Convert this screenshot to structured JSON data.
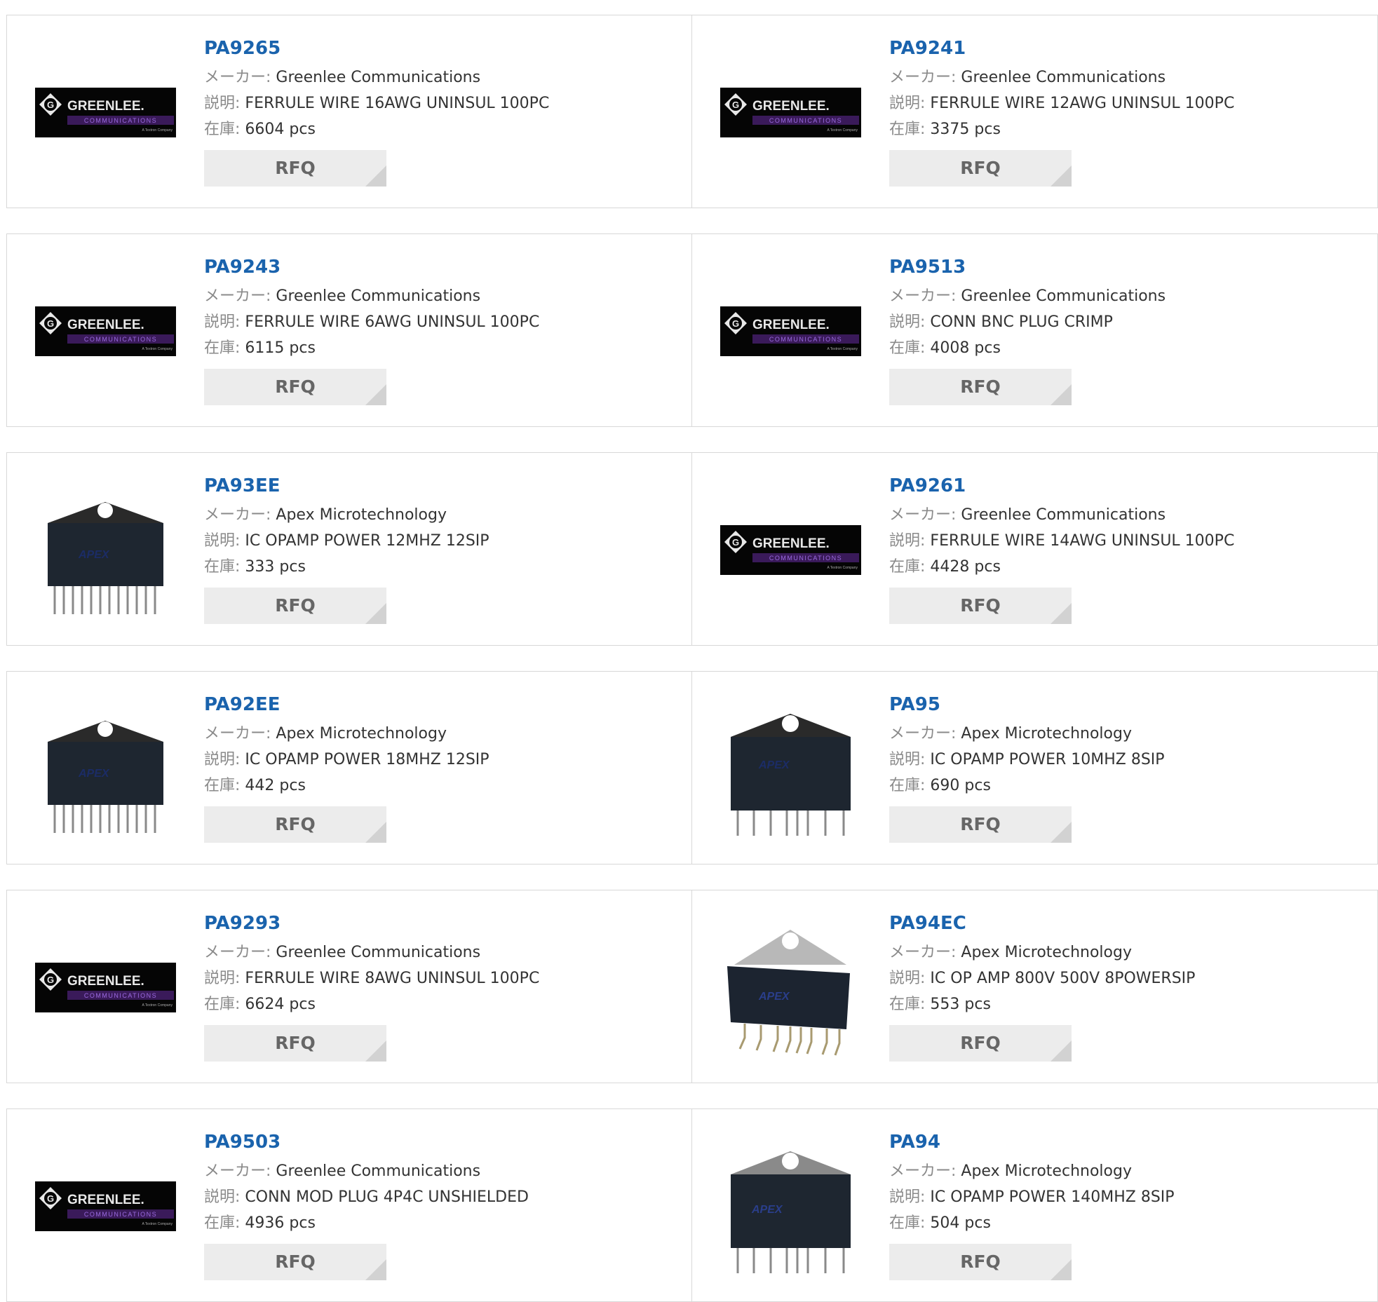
{
  "labels": {
    "maker": "メーカー:",
    "desc": "説明:",
    "stock": "在庫:"
  },
  "rfq_label": "RFQ",
  "logos": {
    "greenlee_wordmark": "GREENLEE.",
    "greenlee_sub": "COMMUNICATIONS",
    "greenlee_tag": "A Textron Company",
    "apex_mark": "APEX"
  },
  "colors": {
    "part_link": "#1a63ad",
    "label_gray": "#8a8a8a",
    "rfq_bg": "#ececec",
    "card_border": "#d8d8d8",
    "greenlee_purple": "#7b3fb5"
  },
  "products": [
    {
      "part": "PA9265",
      "maker": "Greenlee Communications",
      "desc": "FERRULE WIRE 16AWG UNINSUL 100PC",
      "stock": "6604 pcs",
      "image": "greenlee-logo"
    },
    {
      "part": "PA9241",
      "maker": "Greenlee Communications",
      "desc": "FERRULE WIRE 12AWG UNINSUL 100PC",
      "stock": "3375 pcs",
      "image": "greenlee-logo"
    },
    {
      "part": "PA9243",
      "maker": "Greenlee Communications",
      "desc": "FERRULE WIRE 6AWG UNINSUL 100PC",
      "stock": "6115 pcs",
      "image": "greenlee-logo"
    },
    {
      "part": "PA9513",
      "maker": "Greenlee Communications",
      "desc": "CONN BNC PLUG CRIMP",
      "stock": "4008 pcs",
      "image": "greenlee-logo"
    },
    {
      "part": "PA93EE",
      "maker": "Apex Microtechnology",
      "desc": "IC OPAMP POWER 12MHZ 12SIP",
      "stock": "333 pcs",
      "image": "sip-12pin-chip"
    },
    {
      "part": "PA9261",
      "maker": "Greenlee Communications",
      "desc": "FERRULE WIRE 14AWG UNINSUL 100PC",
      "stock": "4428 pcs",
      "image": "greenlee-logo"
    },
    {
      "part": "PA92EE",
      "maker": "Apex Microtechnology",
      "desc": "IC OPAMP POWER 18MHZ 12SIP",
      "stock": "442 pcs",
      "image": "sip-12pin-chip"
    },
    {
      "part": "PA95",
      "maker": "Apex Microtechnology",
      "desc": "IC OPAMP POWER 10MHZ 8SIP",
      "stock": "690 pcs",
      "image": "sip-8pin-chip"
    },
    {
      "part": "PA9293",
      "maker": "Greenlee Communications",
      "desc": "FERRULE WIRE 8AWG UNINSUL 100PC",
      "stock": "6624 pcs",
      "image": "greenlee-logo"
    },
    {
      "part": "PA94EC",
      "maker": "Apex Microtechnology",
      "desc": "IC OP AMP 800V 500V 8POWERSIP",
      "stock": "553 pcs",
      "image": "powersip-angled-chip"
    },
    {
      "part": "PA9503",
      "maker": "Greenlee Communications",
      "desc": "CONN MOD PLUG 4P4C UNSHIELDED",
      "stock": "4936 pcs",
      "image": "greenlee-logo"
    },
    {
      "part": "PA94",
      "maker": "Apex Microtechnology",
      "desc": "IC OPAMP POWER 140MHZ 8SIP",
      "stock": "504 pcs",
      "image": "sip-8pin-chip"
    }
  ]
}
